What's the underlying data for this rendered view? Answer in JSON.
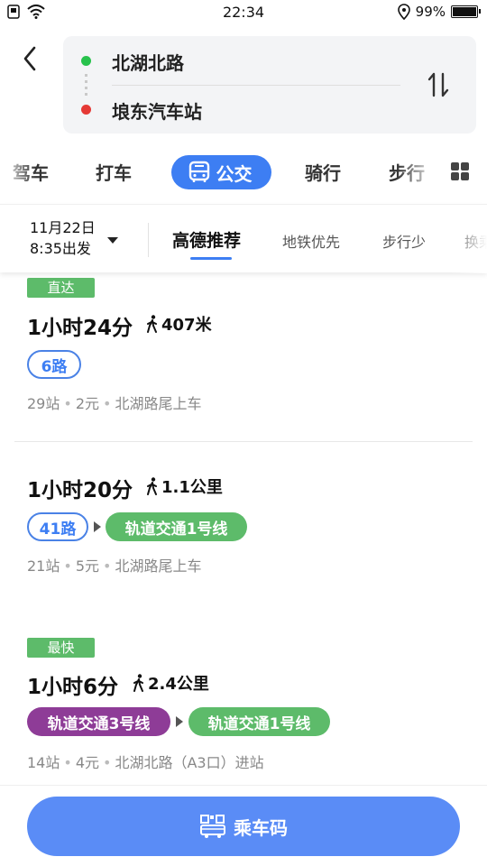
{
  "status_bar": {
    "time": "22:34",
    "battery": "99%",
    "battery_level": 0.99
  },
  "route": {
    "from": "北湖北路",
    "to": "埌东汽车站"
  },
  "modes": [
    {
      "label": "驾车"
    },
    {
      "label": "打车"
    },
    {
      "label": "公交",
      "active": true
    },
    {
      "label": "骑行"
    },
    {
      "label": "步行"
    }
  ],
  "filter": {
    "date": "11月22日",
    "time": "8:35出发",
    "tabs": [
      {
        "label": "高德推荐",
        "active": true
      },
      {
        "label": "地铁优先"
      },
      {
        "label": "步行少"
      },
      {
        "label": "换乘"
      }
    ]
  },
  "routes": [
    {
      "tag": "直达",
      "duration": "1小时24分",
      "walk": "407米",
      "lines": [
        "6路"
      ],
      "stops": "29站",
      "price": "2元",
      "board": "北湖路尾上车"
    },
    {
      "tag": "",
      "duration": "1小时20分",
      "walk": "1.1公里",
      "lines": [
        "41路",
        "轨道交通1号线"
      ],
      "stops": "21站",
      "price": "5元",
      "board": "北湖路尾上车"
    },
    {
      "tag": "最快",
      "duration": "1小时6分",
      "walk": "2.4公里",
      "lines": [
        "轨道交通3号线",
        "轨道交通1号线"
      ],
      "stops": "14站",
      "price": "4元",
      "board": "北湖北路（A3口）进站"
    }
  ],
  "bottom": {
    "button_label": "乘车码"
  },
  "colors": {
    "accent": "#3d7ef3",
    "green_line": "#5dbb6a",
    "purple_line": "#8e3c97",
    "origin_dot": "#27c24c",
    "dest_dot": "#e53935",
    "bottom_button": "#5a8cf6"
  },
  "icons": [
    "back-icon",
    "swap-icon",
    "bus-icon",
    "grid-icon",
    "walk-icon",
    "qr-code-icon",
    "wifi-icon",
    "location-icon",
    "battery-icon"
  ]
}
